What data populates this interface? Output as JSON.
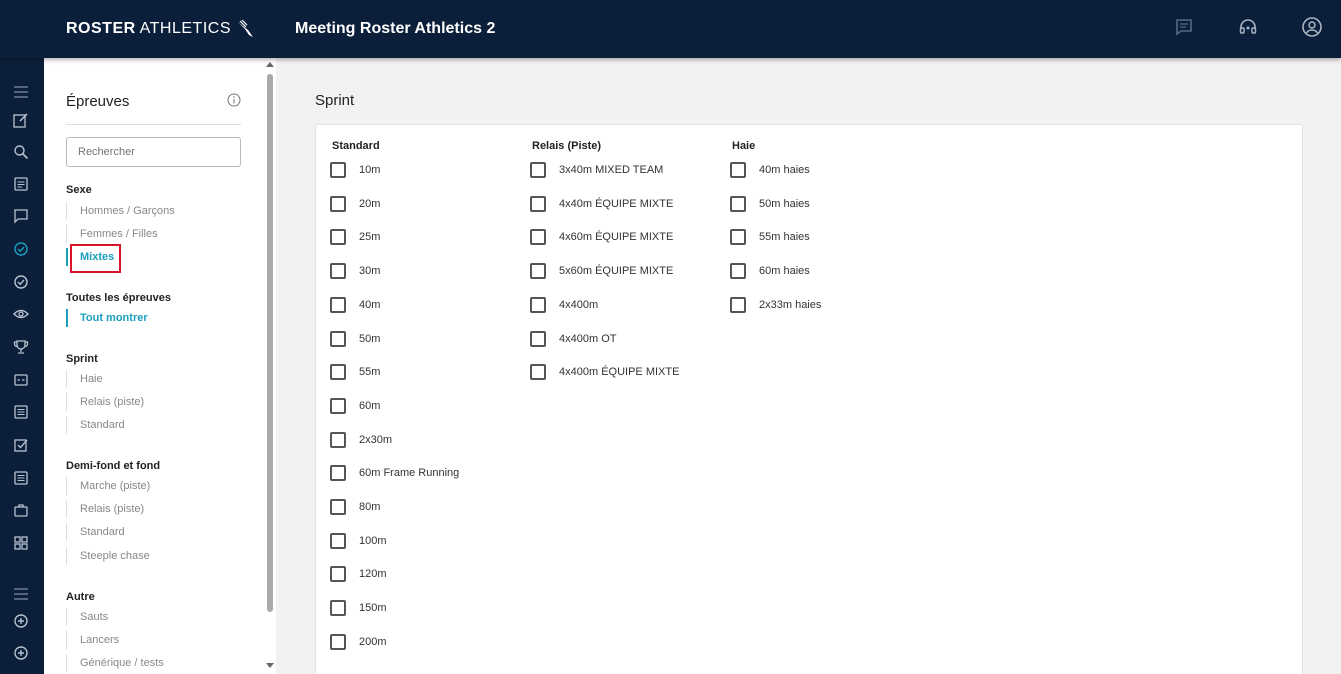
{
  "header": {
    "brand_bold": "ROSTER",
    "brand_light": "ATHLETICS",
    "meeting_title": "Meeting Roster Athletics 2",
    "icons": [
      "chat-icon",
      "support-headset-icon",
      "account-icon"
    ]
  },
  "rail": {
    "icons": [
      "menu-icon",
      "edit-icon",
      "search-icon",
      "list-icon",
      "message-icon",
      "check-circle-icon",
      "check-circle-outline-icon",
      "eye-icon",
      "trophy-icon",
      "scoreboard-icon",
      "newspaper-icon",
      "checkbox-icon",
      "document-icon",
      "briefcase-icon",
      "grid-icon",
      "menu-icon",
      "add-circle-icon",
      "add-circle-icon"
    ]
  },
  "panel": {
    "title": "Épreuves",
    "search_placeholder": "Rechercher",
    "groups": [
      {
        "title": "Sexe",
        "items": [
          "Hommes / Garçons",
          "Femmes / Filles",
          "Mixtes"
        ]
      },
      {
        "title": "Toutes les épreuves",
        "items": [
          "Tout montrer"
        ]
      },
      {
        "title": "Sprint",
        "items": [
          "Haie",
          "Relais (piste)",
          "Standard"
        ]
      },
      {
        "title": "Demi-fond et fond",
        "items": [
          "Marche (piste)",
          "Relais (piste)",
          "Standard",
          "Steeple chase"
        ]
      },
      {
        "title": "Autre",
        "items": [
          "Sauts",
          "Lancers",
          "Générique / tests"
        ]
      }
    ]
  },
  "main": {
    "section_title": "Sprint",
    "columns": [
      {
        "title": "Standard",
        "items": [
          "10m",
          "20m",
          "25m",
          "30m",
          "40m",
          "50m",
          "55m",
          "60m",
          "2x30m",
          "60m Frame Running",
          "80m",
          "100m",
          "120m",
          "150m",
          "200m"
        ]
      },
      {
        "title": "Relais (Piste)",
        "items": [
          "3x40m MIXED TEAM",
          "4x40m ÉQUIPE MIXTE",
          "4x60m ÉQUIPE MIXTE",
          "5x60m ÉQUIPE MIXTE",
          "4x400m",
          "4x400m OT",
          "4x400m ÉQUIPE MIXTE"
        ]
      },
      {
        "title": "Haie",
        "items": [
          "40m haies",
          "50m haies",
          "55m haies",
          "60m haies",
          "2x33m haies"
        ]
      }
    ]
  },
  "colors": {
    "navy": "#0b1f3a",
    "accent": "#1a9fbf",
    "highlight": "#d9142a"
  }
}
